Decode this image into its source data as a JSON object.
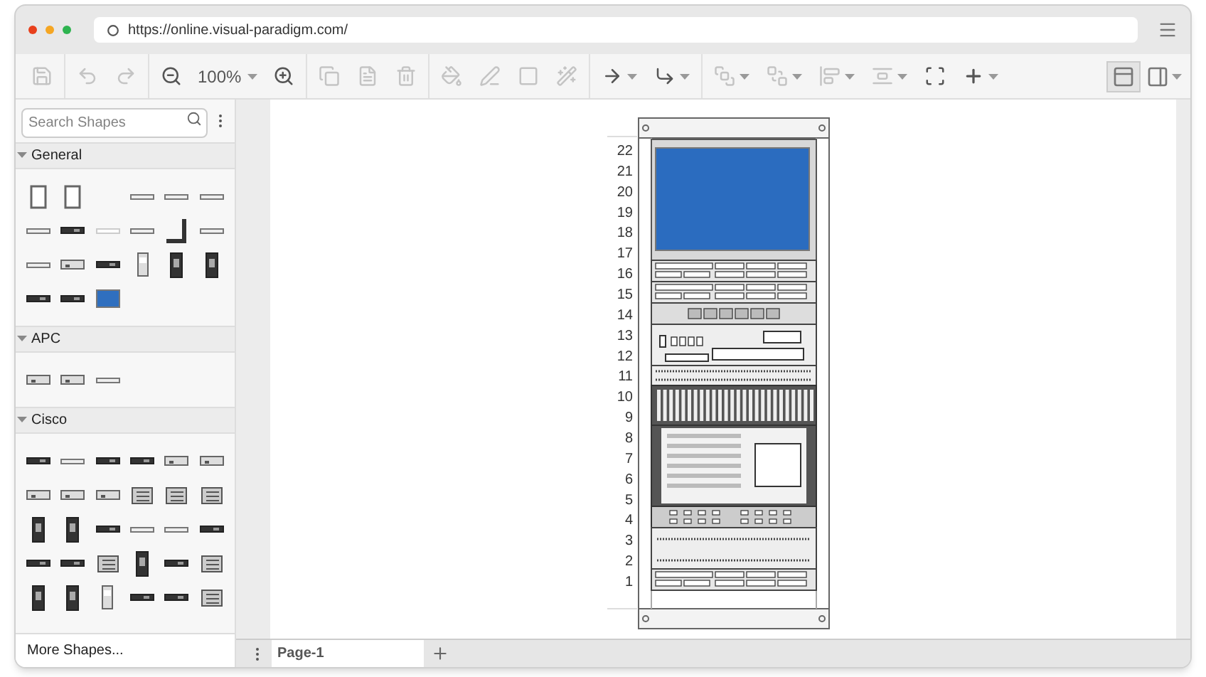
{
  "browser": {
    "url": "https://online.visual-paradigm.com/"
  },
  "toolbar": {
    "groups": [
      [
        {
          "kind": "save",
          "disabled": true,
          "dropdown": false
        }
      ],
      [
        {
          "kind": "undo",
          "disabled": true,
          "dropdown": false
        },
        {
          "kind": "redo",
          "disabled": true,
          "dropdown": false
        }
      ],
      [
        {
          "kind": "zoom-out",
          "disabled": false,
          "dropdown": false
        },
        {
          "kind": "zoom-level",
          "label": "100%",
          "disabled": false,
          "dropdown": true
        },
        {
          "kind": "zoom-in",
          "disabled": false,
          "dropdown": false
        }
      ],
      [
        {
          "kind": "copy",
          "disabled": true,
          "dropdown": false
        },
        {
          "kind": "paste",
          "disabled": true,
          "dropdown": false
        },
        {
          "kind": "delete",
          "disabled": true,
          "dropdown": false
        }
      ],
      [
        {
          "kind": "fill",
          "disabled": true,
          "dropdown": false
        },
        {
          "kind": "line",
          "disabled": true,
          "dropdown": false
        },
        {
          "kind": "shadow",
          "disabled": true,
          "dropdown": false
        },
        {
          "kind": "style",
          "disabled": true,
          "dropdown": false
        }
      ],
      [
        {
          "kind": "connector",
          "disabled": false,
          "dropdown": true
        },
        {
          "kind": "waypoint",
          "disabled": false,
          "dropdown": true
        }
      ],
      [
        {
          "kind": "to-front",
          "disabled": true,
          "dropdown": true
        },
        {
          "kind": "to-back",
          "disabled": true,
          "dropdown": true
        },
        {
          "kind": "align",
          "disabled": true,
          "dropdown": true
        },
        {
          "kind": "distribute",
          "disabled": true,
          "dropdown": true
        },
        {
          "kind": "fit",
          "disabled": false,
          "dropdown": false
        },
        {
          "kind": "insert",
          "disabled": false,
          "dropdown": true
        }
      ]
    ],
    "right": [
      {
        "kind": "format-panel",
        "selected": true,
        "dropdown": false
      },
      {
        "kind": "layout",
        "selected": false,
        "dropdown": true
      }
    ]
  },
  "sidebar": {
    "search": {
      "placeholder": "Search Shapes"
    },
    "sections": [
      {
        "title": "General",
        "expanded": true,
        "shapes": [
          {
            "kind": "panel"
          },
          {
            "kind": "panel"
          },
          {
            "kind": "blank"
          },
          {
            "kind": "bar"
          },
          {
            "kind": "bar"
          },
          {
            "kind": "bar"
          },
          {
            "kind": "bar"
          },
          {
            "kind": "bar-dark"
          },
          {
            "kind": "bar-light"
          },
          {
            "kind": "bar"
          },
          {
            "kind": "corner"
          },
          {
            "kind": "bar"
          },
          {
            "kind": "bar"
          },
          {
            "kind": "box"
          },
          {
            "kind": "bar-dark"
          },
          {
            "kind": "tower"
          },
          {
            "kind": "tower-dark"
          },
          {
            "kind": "tower-dark"
          },
          {
            "kind": "bar-dark"
          },
          {
            "kind": "bar-dark"
          },
          {
            "kind": "monitor"
          }
        ]
      },
      {
        "title": "APC",
        "expanded": true,
        "shapes": [
          {
            "kind": "box"
          },
          {
            "kind": "box"
          },
          {
            "kind": "bar"
          }
        ]
      },
      {
        "title": "Cisco",
        "expanded": true,
        "shapes": [
          {
            "kind": "bar-dark"
          },
          {
            "kind": "bar"
          },
          {
            "kind": "bar-dark"
          },
          {
            "kind": "bar-dark"
          },
          {
            "kind": "box"
          },
          {
            "kind": "box"
          },
          {
            "kind": "box"
          },
          {
            "kind": "box"
          },
          {
            "kind": "box"
          },
          {
            "kind": "box-lines"
          },
          {
            "kind": "box-lines"
          },
          {
            "kind": "box-lines"
          },
          {
            "kind": "tower-dark"
          },
          {
            "kind": "tower-dark"
          },
          {
            "kind": "bar-dark"
          },
          {
            "kind": "bar"
          },
          {
            "kind": "bar"
          },
          {
            "kind": "bar-dark"
          },
          {
            "kind": "bar-dark"
          },
          {
            "kind": "bar-dark"
          },
          {
            "kind": "box-lines"
          },
          {
            "kind": "tower-dark"
          },
          {
            "kind": "bar-dark"
          },
          {
            "kind": "box-lines"
          },
          {
            "kind": "tower-dark"
          },
          {
            "kind": "tower-dark"
          },
          {
            "kind": "tower"
          },
          {
            "kind": "bar-dark"
          },
          {
            "kind": "bar-dark"
          },
          {
            "kind": "box-lines"
          }
        ]
      }
    ],
    "more": "More Shapes..."
  },
  "canvas": {
    "rack_units": [
      "22",
      "21",
      "20",
      "19",
      "18",
      "17",
      "16",
      "15",
      "14",
      "13",
      "12",
      "11",
      "10",
      "9",
      "8",
      "7",
      "6",
      "5",
      "4",
      "3",
      "2",
      "1"
    ]
  },
  "pages": {
    "tabs": [
      {
        "label": "Page-1",
        "selected": true
      }
    ]
  }
}
